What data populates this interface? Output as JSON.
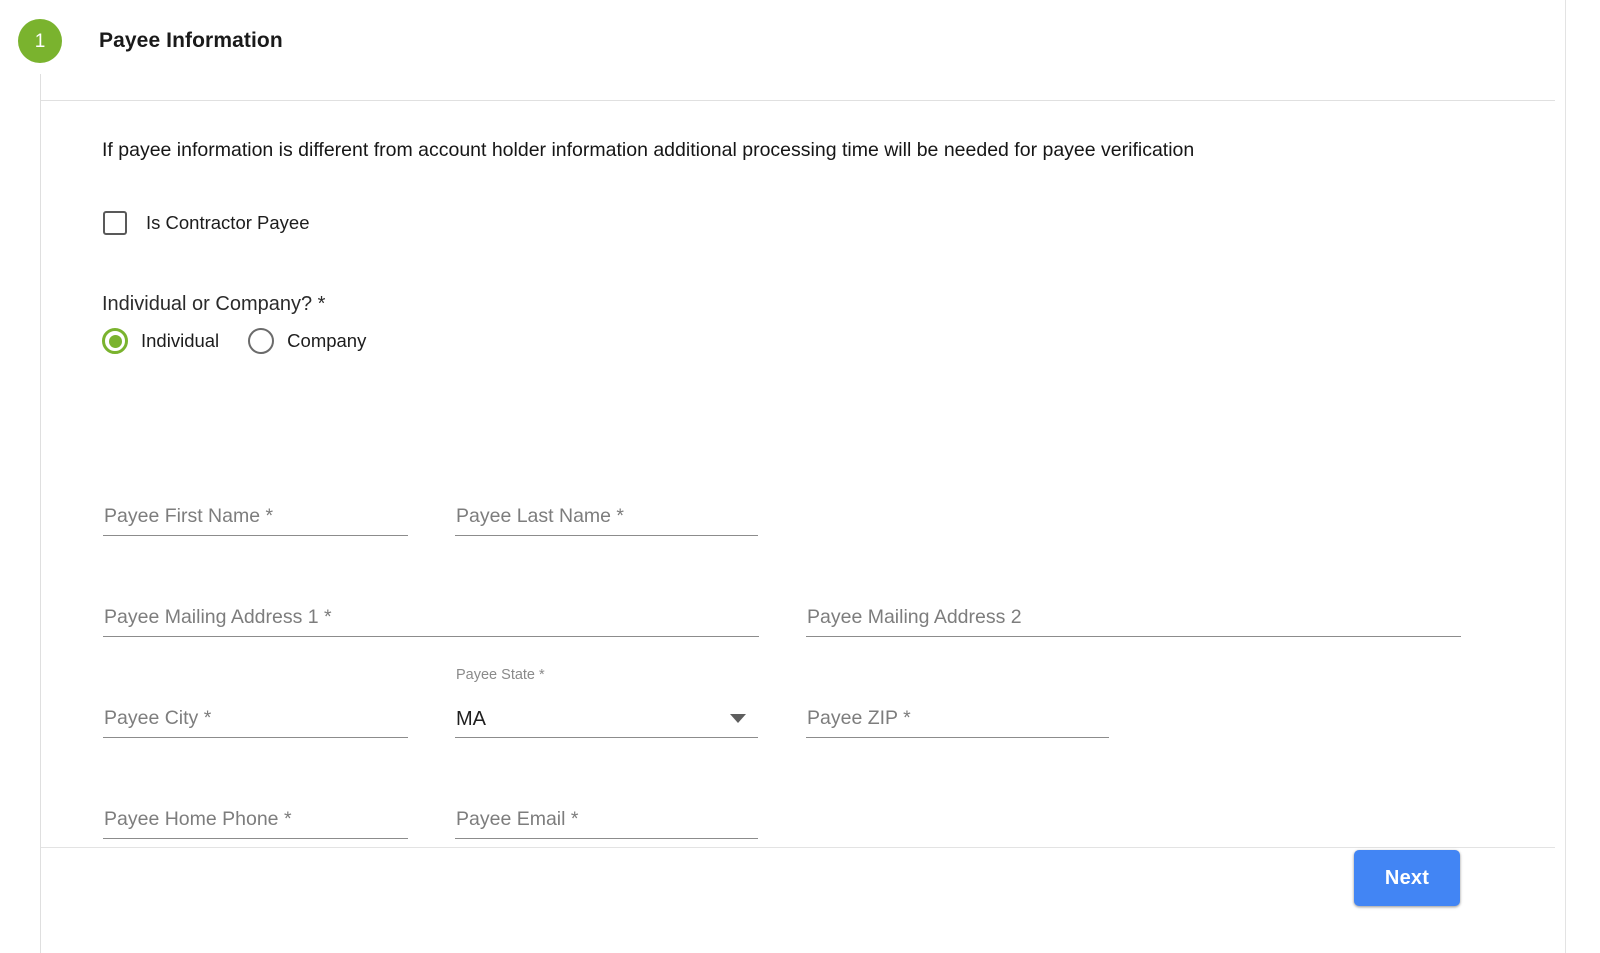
{
  "step": {
    "number": "1",
    "title": "Payee Information",
    "badge_color": "#7ab32e"
  },
  "intro": {
    "text": "If payee information is different from account holder information additional processing time will be needed for payee verification"
  },
  "contractor_checkbox": {
    "label": "Is Contractor Payee",
    "checked": false
  },
  "entity_type": {
    "question": "Individual or Company? *",
    "selected": "Individual",
    "options": [
      {
        "label": "Individual",
        "selected": true
      },
      {
        "label": "Company",
        "selected": false
      }
    ],
    "accent_color": "#7ab32e"
  },
  "fields": {
    "first_name": {
      "placeholder": "Payee First Name *",
      "value": ""
    },
    "last_name": {
      "placeholder": "Payee Last Name *",
      "value": ""
    },
    "address1": {
      "placeholder": "Payee Mailing Address 1 *",
      "value": ""
    },
    "address2": {
      "placeholder": "Payee Mailing Address 2",
      "value": ""
    },
    "city": {
      "placeholder": "Payee City *",
      "value": ""
    },
    "state": {
      "label": "Payee State *",
      "value": "MA"
    },
    "zip": {
      "placeholder": "Payee ZIP *",
      "value": ""
    },
    "home_phone": {
      "placeholder": "Payee Home Phone *",
      "value": ""
    },
    "email": {
      "placeholder": "Payee Email *",
      "value": ""
    }
  },
  "footer": {
    "next_label": "Next",
    "next_color": "#4285f4"
  }
}
